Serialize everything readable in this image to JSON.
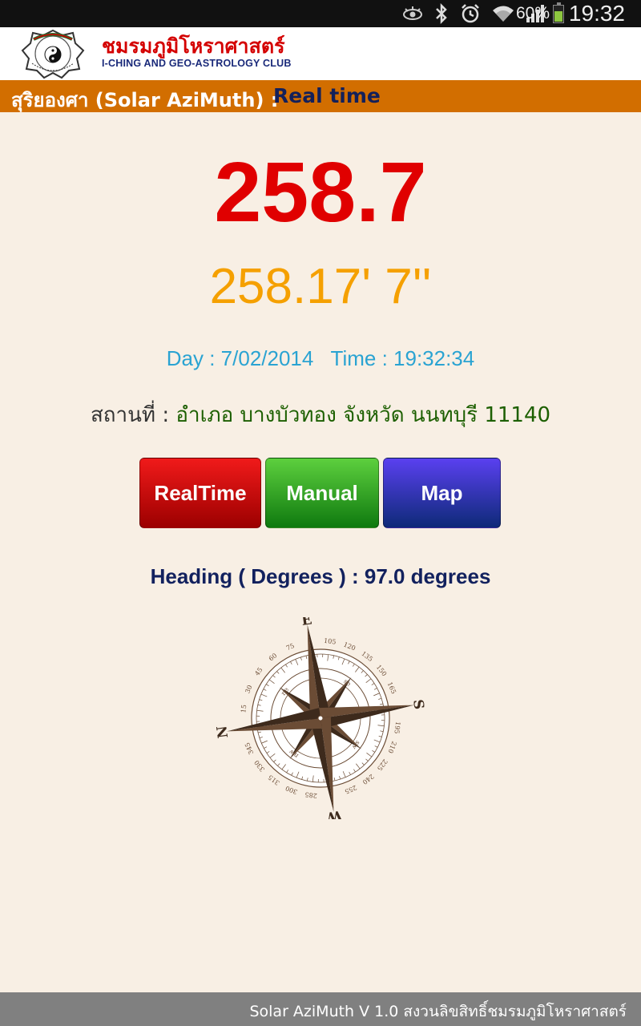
{
  "status_bar": {
    "battery_percent": "60%",
    "battery_level": 0.6,
    "time": "19:32",
    "icons": [
      "eye-icon",
      "bluetooth-icon",
      "alarm-icon",
      "wifi-icon",
      "signal-icon",
      "battery-icon"
    ]
  },
  "header": {
    "brand_thai": "ชมรมภูมิโหราศาสตร์",
    "brand_en": "I-CHING AND GEO-ASTROLOGY CLUB"
  },
  "title_bar": {
    "label": "สุริยองศา (Solar AziMuth) :",
    "mode": "Real time"
  },
  "main": {
    "azimuth": "258.7",
    "azimuth_dms": "258.17' 7''",
    "datetime": "Day : 7/02/2014   Time : 19:32:34",
    "location_label": "สถานที่ :",
    "location_value": "อำเภอ บางบัวทอง จังหวัด นนทบุรี 11140"
  },
  "buttons": {
    "realtime": "RealTime",
    "manual": "Manual",
    "map": "Map"
  },
  "heading_text": "Heading ( Degrees ) : 97.0 degrees",
  "compass": {
    "heading_deg": 97.0,
    "cardinals": {
      "top": "E",
      "right": "S",
      "bottom": "W",
      "left": "N"
    },
    "intercardinals": [
      "se",
      "sw",
      "nw",
      "ne"
    ],
    "degree_labels": [
      "105",
      "120",
      "135",
      "150",
      "165",
      "195",
      "210",
      "225",
      "240",
      "255",
      "285",
      "300",
      "315",
      "330",
      "345",
      "15",
      "30",
      "45",
      "60",
      "75"
    ]
  },
  "colors": {
    "title_bar": "#d26e00",
    "azimuth": "#e00000",
    "azimuth_dms": "#f5a000",
    "datetime": "#2aa3d2",
    "compass": "#6b4c35"
  },
  "footer": {
    "text": "Solar AziMuth V 1.0 สงวนลิขสิทธิ์ชมรมภูมิโหราศาสตร์"
  }
}
